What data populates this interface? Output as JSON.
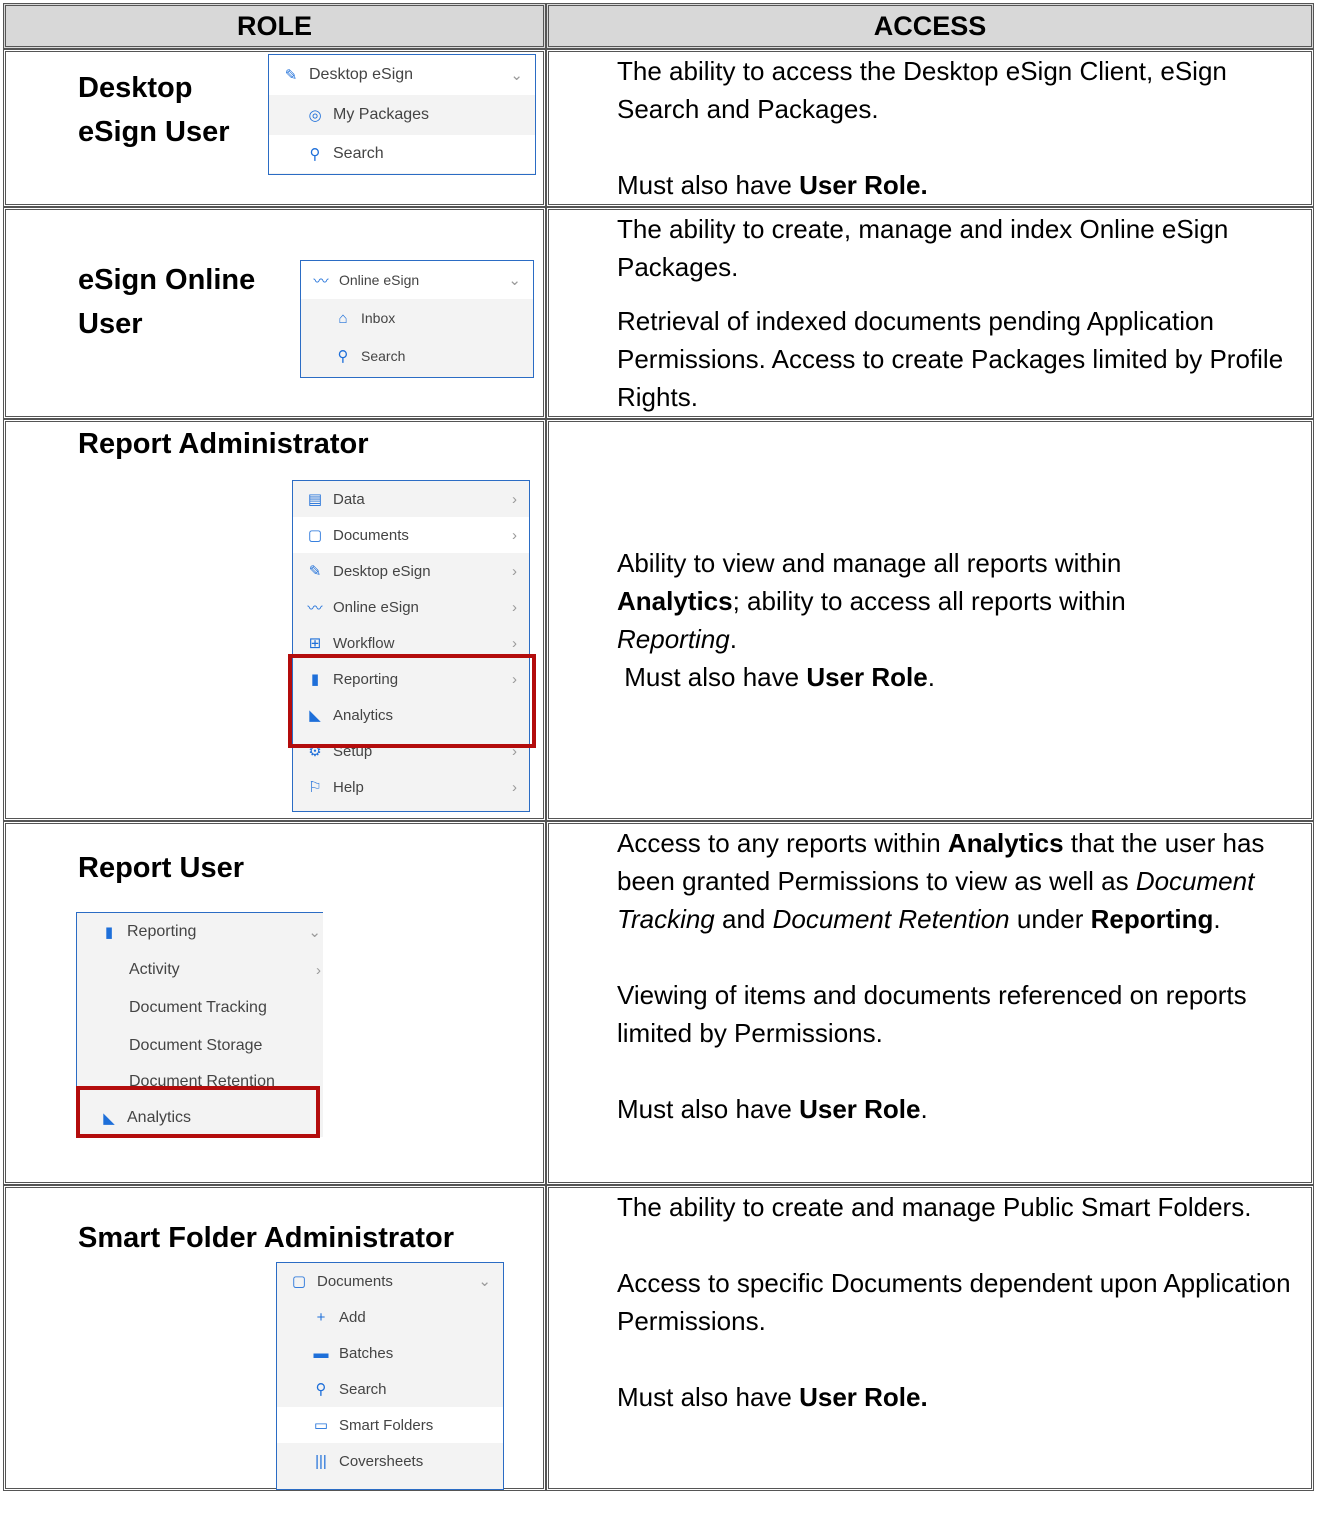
{
  "table": {
    "header_role": "ROLE",
    "header_access": "ACCESS"
  },
  "rows": [
    {
      "role_line1": "Desktop",
      "role_line2": "eSign User",
      "menu": {
        "header": "Desktop eSign",
        "items": [
          "My Packages",
          "Search"
        ]
      },
      "access_p1": "The ability to access the Desktop eSign Client, eSign Search and Packages.",
      "access_p2_prefix": "Must also have ",
      "access_p2_bold": "User Role."
    },
    {
      "role_line1": "eSign Online",
      "role_line2": "User",
      "menu": {
        "header": "Online eSign",
        "items": [
          "Inbox",
          "Search"
        ]
      },
      "access_p1": "The ability to create, manage and index Online eSign Packages.",
      "access_p2": "Retrieval of indexed documents pending Application Permissions.  Access to create Packages limited by Profile Rights."
    },
    {
      "role": "Report Administrator",
      "menu": {
        "items": [
          "Data",
          "Documents",
          "Desktop eSign",
          "Online eSign",
          "Workflow",
          "Reporting",
          "Analytics",
          "Setup",
          "Help"
        ]
      },
      "access_l1": "Ability to view and manage all reports within",
      "access_l2_bold": "Analytics",
      "access_l2_rest": "; ability to access all reports within",
      "access_l3_italic": "Reporting",
      "access_l3_rest": ".",
      "access_l4_prefix": " Must also have ",
      "access_l4_bold": "User Role",
      "access_l4_rest": "."
    },
    {
      "role": "Report User",
      "menu": {
        "header": "Reporting",
        "items": [
          "Activity",
          "Document Tracking",
          "Document Storage",
          "Document Retention",
          "Analytics"
        ]
      },
      "access_p1_a": "Access to any reports within ",
      "access_p1_bold1": "Analytics",
      "access_p1_b": " that the user has been granted Permissions to view as well as ",
      "access_p1_italic1": "Document Tracking",
      "access_p1_c": " and ",
      "access_p1_italic2": "Document Retention",
      "access_p1_d": " under ",
      "access_p1_bold2": "Reporting",
      "access_p1_e": ".",
      "access_p2": "Viewing of items and documents referenced on reports limited by Permissions.",
      "access_p3_prefix": "Must also have ",
      "access_p3_bold": "User Role",
      "access_p3_rest": "."
    },
    {
      "role": "Smart Folder Administrator",
      "menu": {
        "header": "Documents",
        "items": [
          "Add",
          "Batches",
          "Search",
          "Smart Folders",
          "Coversheets"
        ]
      },
      "access_p1": "The ability to create and manage Public Smart Folders.",
      "access_p2": "Access to specific Documents dependent upon Application Permissions.",
      "access_p3_prefix": "Must also have ",
      "access_p3_bold": "User Role."
    }
  ],
  "colors": {
    "header_bg": "#d8d8d8",
    "menu_accent": "#1e6fd9",
    "highlight_red": "#b30c0c"
  }
}
